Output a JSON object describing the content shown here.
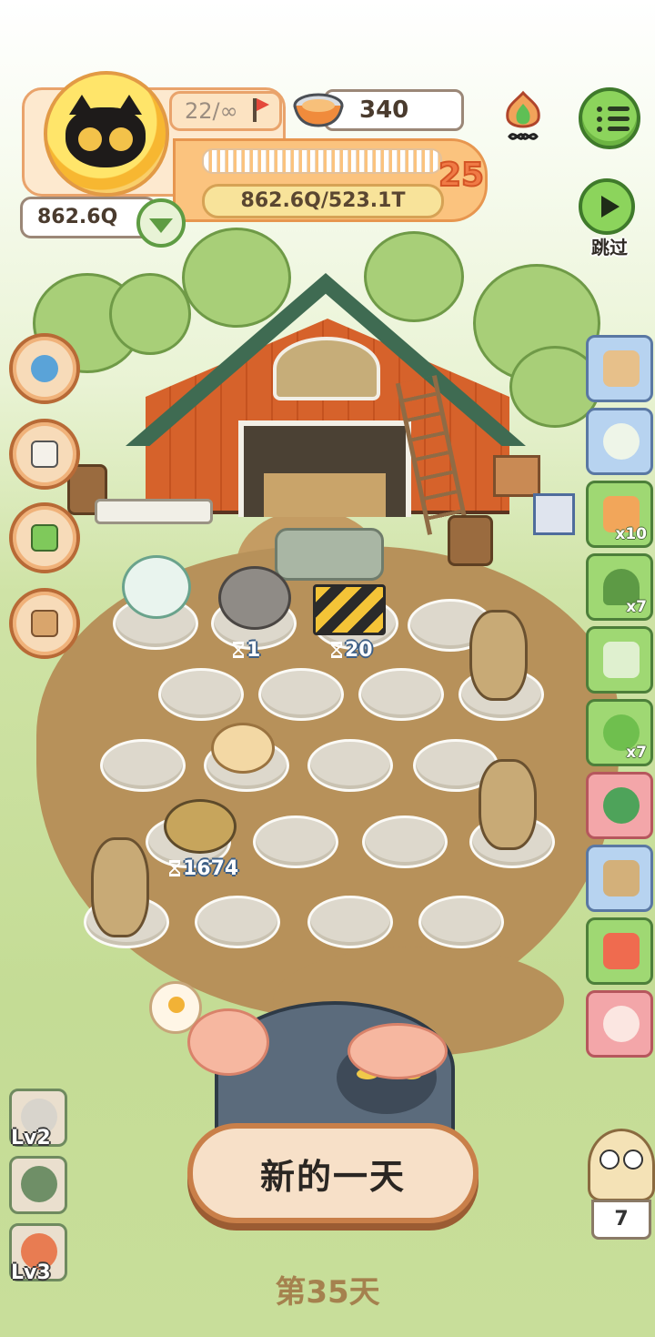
{
  "hud": {
    "player_level_count": "22/∞",
    "coins": "862.6Q",
    "food": "340",
    "exp_text": "862.6Q/523.1T",
    "level": "25"
  },
  "buttons": {
    "skip_label": "跳过",
    "new_day_label": "新的一天"
  },
  "field": {
    "timers": [
      {
        "value": "1"
      },
      {
        "value": "20"
      },
      {
        "value": "1674"
      }
    ]
  },
  "right_items": [
    {
      "icon": "chest-icon",
      "count": ""
    },
    {
      "icon": "leaf-icon",
      "count": ""
    },
    {
      "icon": "ticket-icon",
      "count": "x10"
    },
    {
      "icon": "helmet-icon",
      "count": "x7"
    },
    {
      "icon": "voucher-icon",
      "count": ""
    },
    {
      "icon": "lollipop-icon",
      "count": "x7"
    },
    {
      "icon": "bush-icon",
      "count": ""
    },
    {
      "icon": "hut-icon",
      "count": ""
    },
    {
      "icon": "cancel-ticket-icon",
      "count": ""
    },
    {
      "icon": "heart-gift-icon",
      "count": ""
    }
  ],
  "side_chars": [
    {
      "level": "Lv2"
    },
    {
      "level": ""
    },
    {
      "level": "Lv3"
    }
  ],
  "owl_count": "7",
  "day_label": "第35天",
  "colors": {
    "accent_green": "#8cd45c",
    "panel_orange": "#fbc37e",
    "dirt": "#b7915a"
  }
}
